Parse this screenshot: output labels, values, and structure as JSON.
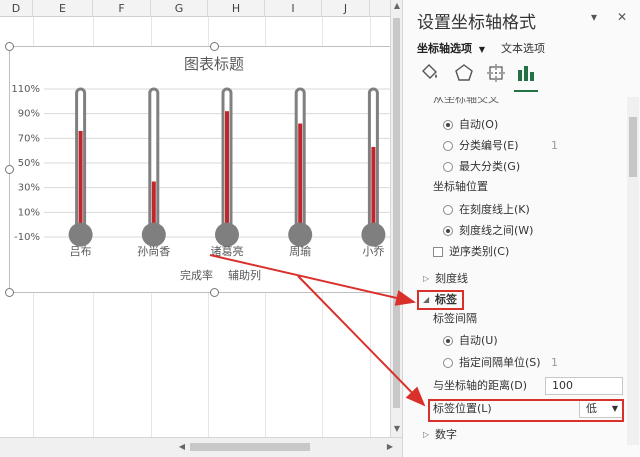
{
  "sheet": {
    "columns": [
      "D",
      "E",
      "F",
      "G",
      "H",
      "I",
      "J"
    ]
  },
  "chart": {
    "title": "图表标题",
    "legend": [
      "完成率",
      "辅助列"
    ],
    "colors": {
      "fill": "#c0272d",
      "tube": "#808080",
      "bulb": "#7f7f7f",
      "axis": "#d9d9d9"
    }
  },
  "chart_data": {
    "type": "bar",
    "title": "图表标题",
    "categories": [
      "吕布",
      "孙尚香",
      "诸葛亮",
      "周瑜",
      "小乔"
    ],
    "series": [
      {
        "name": "完成率",
        "values": [
          0.76,
          0.35,
          0.92,
          0.82,
          0.63
        ]
      },
      {
        "name": "辅助列",
        "values": [
          1.1,
          1.1,
          1.1,
          1.1,
          1.1
        ]
      }
    ],
    "yticks": [
      "110%",
      "90%",
      "70%",
      "50%",
      "30%",
      "10%",
      "-10%"
    ],
    "ylim": [
      -0.1,
      1.1
    ],
    "legend_position": "bottom",
    "grid": true
  },
  "pane": {
    "title": "设置坐标轴格式",
    "dropdown_icon": "chevron-down-icon",
    "close_icon": "close-icon",
    "tabs": {
      "axis_options": "坐标轴选项",
      "text_options": "文本选项"
    },
    "icons": [
      "fill-bucket-icon",
      "pentagon-icon",
      "size-properties-icon",
      "bar-chart-icon"
    ],
    "partial_header": "从坐标轴交叉",
    "crosses": {
      "auto": "自动(O)",
      "category_number": "分类编号(E)",
      "category_number_value": "1",
      "max_category": "最大分类(G)"
    },
    "position_header": "坐标轴位置",
    "position": {
      "on_ticks": "在刻度线上(K)",
      "between_ticks": "刻度线之间(W)"
    },
    "reverse": "逆序类别(C)",
    "tick_marks": "刻度线",
    "labels": "标签",
    "label_interval_header": "标签间隔",
    "interval": {
      "auto": "自动(U)",
      "specify": "指定间隔单位(S)",
      "specify_value": "1"
    },
    "distance_label": "与坐标轴的距离(D)",
    "distance_value": "100",
    "label_position_label": "标签位置(L)",
    "label_position_value": "低",
    "number": "数字"
  }
}
